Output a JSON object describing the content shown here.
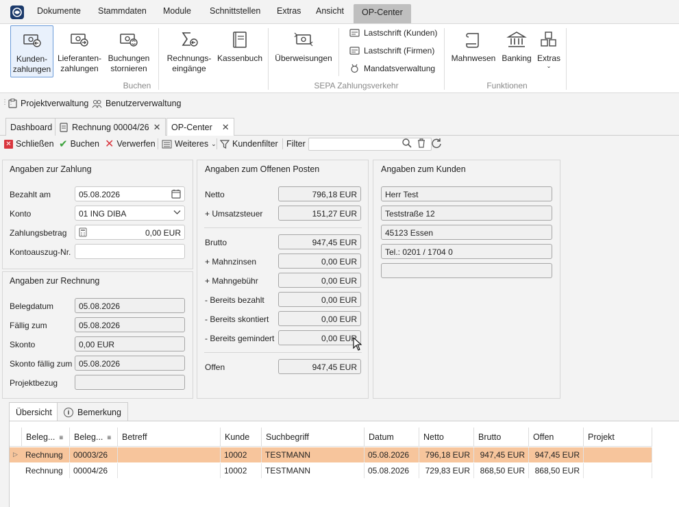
{
  "menu": {
    "items": [
      "Dokumente",
      "Stammdaten",
      "Module",
      "Schnittstellen",
      "Extras",
      "Ansicht"
    ],
    "active": "OP-Center"
  },
  "ribbon": {
    "buchen": {
      "kunden": "Kunden-\nzahlungen",
      "lieferanten": "Lieferanten-\nzahlungen",
      "stornieren": "Buchungen\nstornieren",
      "rechnungseingaenge": "Rechnungs-\neingänge",
      "kassenbuch": "Kassenbuch",
      "group": "Buchen"
    },
    "sepa": {
      "ueberweisungen": "Überweisungen",
      "lastschrift_kunden": "Lastschrift (Kunden)",
      "lastschrift_firmen": "Lastschrift (Firmen)",
      "mandatsverwaltung": "Mandatsverwaltung",
      "group": "SEPA Zahlungsverkehr"
    },
    "funktionen": {
      "mahnwesen": "Mahnwesen",
      "banking": "Banking",
      "extras": "Extras",
      "group": "Funktionen"
    }
  },
  "bar2": {
    "projektverwaltung": "Projektverwaltung",
    "benutzerverwaltung": "Benutzerverwaltung"
  },
  "tabs": {
    "dashboard": "Dashboard",
    "rechnung": "Rechnung 00004/26",
    "opcenter": "OP-Center"
  },
  "toolbar": {
    "schliessen": "Schließen",
    "buchen": "Buchen",
    "verwerfen": "Verwerfen",
    "weiteres": "Weiteres",
    "kundenfilter": "Kundenfilter",
    "filter_label": "Filter",
    "filter_value": ""
  },
  "zahlung": {
    "title": "Angaben zur Zahlung",
    "bezahlt_am_label": "Bezahlt am",
    "bezahlt_am": "05.08.2026",
    "konto_label": "Konto",
    "konto": "01 ING DIBA",
    "betrag_label": "Zahlungsbetrag",
    "betrag": "0,00 EUR",
    "auszug_label": "Kontoauszug-Nr.",
    "auszug": ""
  },
  "rechnung": {
    "title": "Angaben zur Rechnung",
    "belegdatum_label": "Belegdatum",
    "belegdatum": "05.08.2026",
    "faellig_label": "Fällig zum",
    "faellig": "05.08.2026",
    "skonto_label": "Skonto",
    "skonto": "0,00 EUR",
    "skonto_faellig_label": "Skonto fällig zum",
    "skonto_faellig": "05.08.2026",
    "projekt_label": "Projektbezug",
    "projekt": ""
  },
  "op": {
    "title": "Angaben zum Offenen Posten",
    "netto_label": "Netto",
    "netto": "796,18 EUR",
    "ust_label": "+ Umsatzsteuer",
    "ust": "151,27 EUR",
    "brutto_label": "Brutto",
    "brutto": "947,45 EUR",
    "mahnzinsen_label": "+ Mahnzinsen",
    "mahnzinsen": "0,00 EUR",
    "mahngebuehr_label": "+ Mahngebühr",
    "mahngebuehr": "0,00 EUR",
    "bezahlt_label": "- Bereits bezahlt",
    "bezahlt": "0,00 EUR",
    "skontiert_label": "- Bereits skontiert",
    "skontiert": "0,00 EUR",
    "gemindert_label": "- Bereits gemindert",
    "gemindert": "0,00 EUR",
    "offen_label": "Offen",
    "offen": "947,45 EUR"
  },
  "kunde": {
    "title": "Angaben zum Kunden",
    "name": "Herr Test",
    "strasse": "Teststraße 12",
    "ort": "45123 Essen",
    "tel": "Tel.: 0201 / 1704 0",
    "extra": ""
  },
  "bottom_tabs": {
    "uebersicht": "Übersicht",
    "bemerkung": "Bemerkung"
  },
  "grid": {
    "headers": [
      "Beleg...",
      "Beleg...",
      "Betreff",
      "Kunde",
      "Suchbegriff",
      "Datum",
      "Netto",
      "Brutto",
      "Offen",
      "Projekt"
    ],
    "rows": [
      [
        "Rechnung",
        "00003/26",
        "",
        "10002",
        "TESTMANN",
        "05.08.2026",
        "796,18 EUR",
        "947,45 EUR",
        "947,45 EUR",
        ""
      ],
      [
        "Rechnung",
        "00004/26",
        "",
        "10002",
        "TESTMANN",
        "05.08.2026",
        "729,83 EUR",
        "868,50 EUR",
        "868,50 EUR",
        ""
      ]
    ],
    "selected_color": "#f7c59c"
  },
  "colors": {
    "accent": "#2d6fc7",
    "menu_active_bg": "#bfbfbf"
  }
}
